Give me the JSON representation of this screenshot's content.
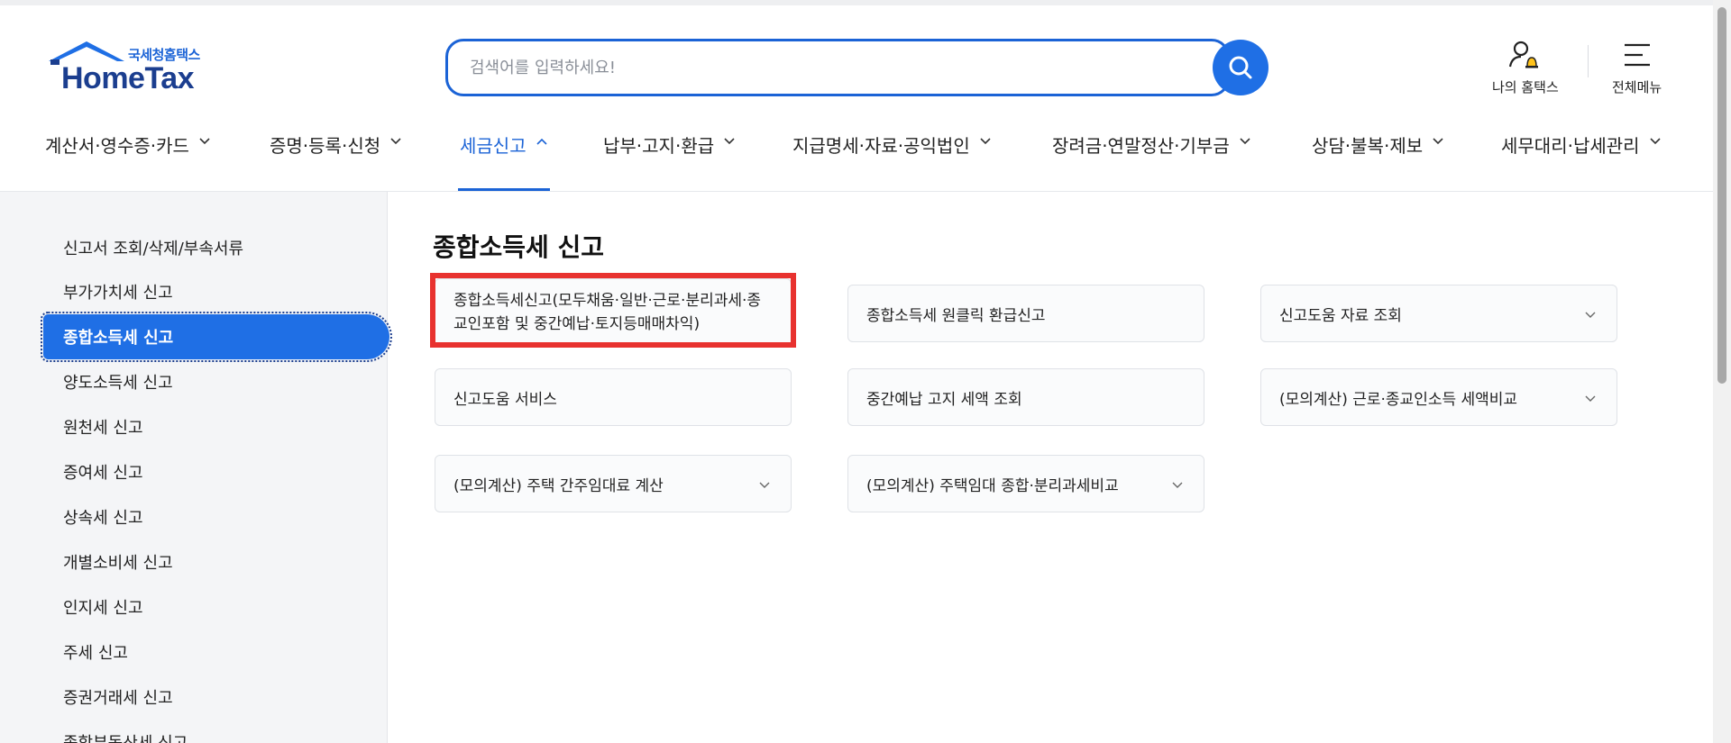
{
  "logo": {
    "korean": "국세청홈택스",
    "english": "HomeTax"
  },
  "search": {
    "placeholder": "검색어를 입력하세요!",
    "value": ""
  },
  "utilities": {
    "my_hometax": "나의 홈택스",
    "all_menu": "전체메뉴"
  },
  "gnb": [
    {
      "label": "계산서·영수증·카드",
      "active": false
    },
    {
      "label": "증명·등록·신청",
      "active": false
    },
    {
      "label": "세금신고",
      "active": true
    },
    {
      "label": "납부·고지·환급",
      "active": false
    },
    {
      "label": "지급명세·자료·공익법인",
      "active": false
    },
    {
      "label": "장려금·연말정산·기부금",
      "active": false
    },
    {
      "label": "상담·불복·제보",
      "active": false
    },
    {
      "label": "세무대리·납세관리",
      "active": false
    }
  ],
  "lnb": [
    {
      "label": "신고서 조회/삭제/부속서류",
      "active": false
    },
    {
      "label": "부가가치세 신고",
      "active": false
    },
    {
      "label": "종합소득세 신고",
      "active": true
    },
    {
      "label": "양도소득세 신고",
      "active": false
    },
    {
      "label": "원천세 신고",
      "active": false
    },
    {
      "label": "증여세 신고",
      "active": false
    },
    {
      "label": "상속세 신고",
      "active": false
    },
    {
      "label": "개별소비세 신고",
      "active": false
    },
    {
      "label": "인지세 신고",
      "active": false
    },
    {
      "label": "주세 신고",
      "active": false
    },
    {
      "label": "증권거래세 신고",
      "active": false
    },
    {
      "label": "종합부동산세 신고",
      "active": false
    }
  ],
  "main": {
    "title": "종합소득세 신고",
    "cards": [
      {
        "label": "종합소득세신고(모두채움·일반·근로·분리과세·종교인포함 및 중간예납·토지등매매차익)",
        "expandable": false,
        "highlighted": true
      },
      {
        "label": "종합소득세 원클릭 환급신고",
        "expandable": false,
        "highlighted": false
      },
      {
        "label": "신고도움 자료 조회",
        "expandable": true,
        "highlighted": false
      },
      {
        "label": "신고도움 서비스",
        "expandable": false,
        "highlighted": false
      },
      {
        "label": "중간예납 고지 세액 조회",
        "expandable": false,
        "highlighted": false
      },
      {
        "label": "(모의계산) 근로·종교인소득 세액비교",
        "expandable": true,
        "highlighted": false
      },
      {
        "label": "(모의계산) 주택 간주임대료 계산",
        "expandable": true,
        "highlighted": false
      },
      {
        "label": "(모의계산) 주택임대 종합·분리과세비교",
        "expandable": true,
        "highlighted": false
      }
    ]
  },
  "colors": {
    "primary": "#1f6fe5",
    "brand_dark": "#1b3e8f",
    "highlight_red": "#e8322f"
  }
}
